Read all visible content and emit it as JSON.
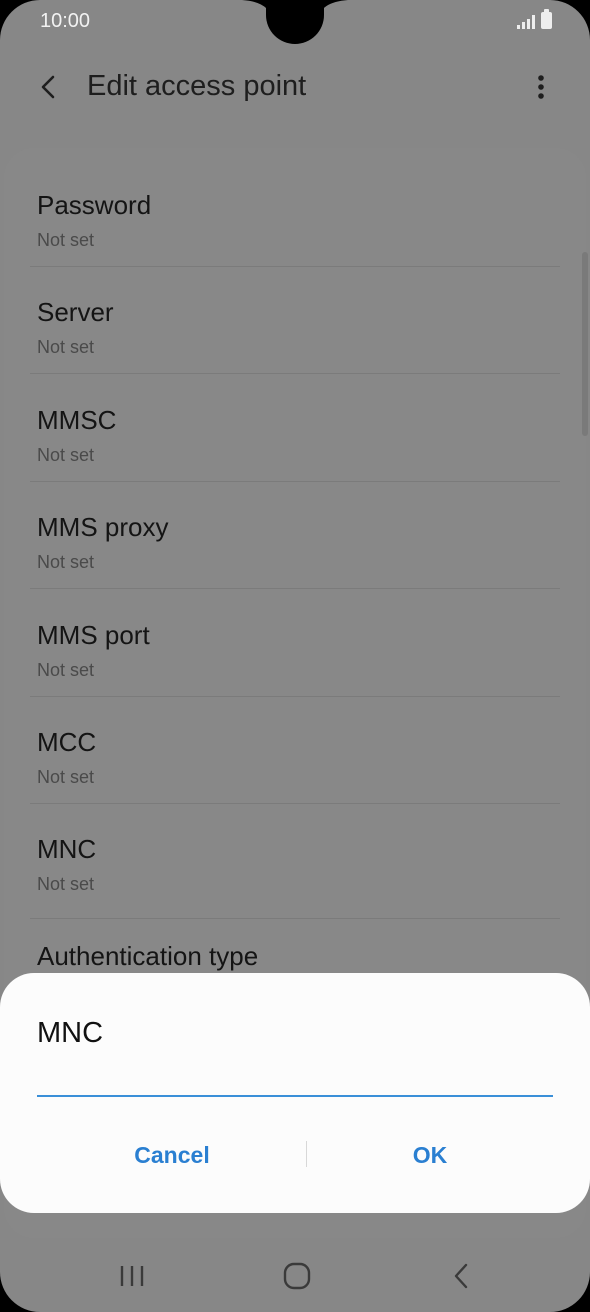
{
  "status_bar": {
    "time": "10:00",
    "icons": [
      "signal-icon",
      "battery-icon"
    ]
  },
  "app_bar": {
    "title": "Edit access point",
    "back_icon": "chevron-left-icon",
    "more_icon": "more-vertical-icon"
  },
  "settings": [
    {
      "title": "Password",
      "value": "Not set"
    },
    {
      "title": "Server",
      "value": "Not set"
    },
    {
      "title": "MMSC",
      "value": "Not set"
    },
    {
      "title": "MMS proxy",
      "value": "Not set"
    },
    {
      "title": "MMS port",
      "value": "Not set"
    },
    {
      "title": "MCC",
      "value": "Not set"
    },
    {
      "title": "MNC",
      "value": "Not set"
    },
    {
      "title": "Authentication type",
      "value": ""
    }
  ],
  "dialog": {
    "title": "MNC",
    "input_value": "",
    "cancel_label": "Cancel",
    "ok_label": "OK"
  },
  "nav_bar": {
    "icons": [
      "recent-apps-icon",
      "home-icon",
      "back-icon"
    ]
  },
  "colors": {
    "accent": "#2a7fd1",
    "input_underline": "#3a8fd8",
    "scrim_background": "#878787",
    "dialog_background": "#fcfcfc"
  }
}
